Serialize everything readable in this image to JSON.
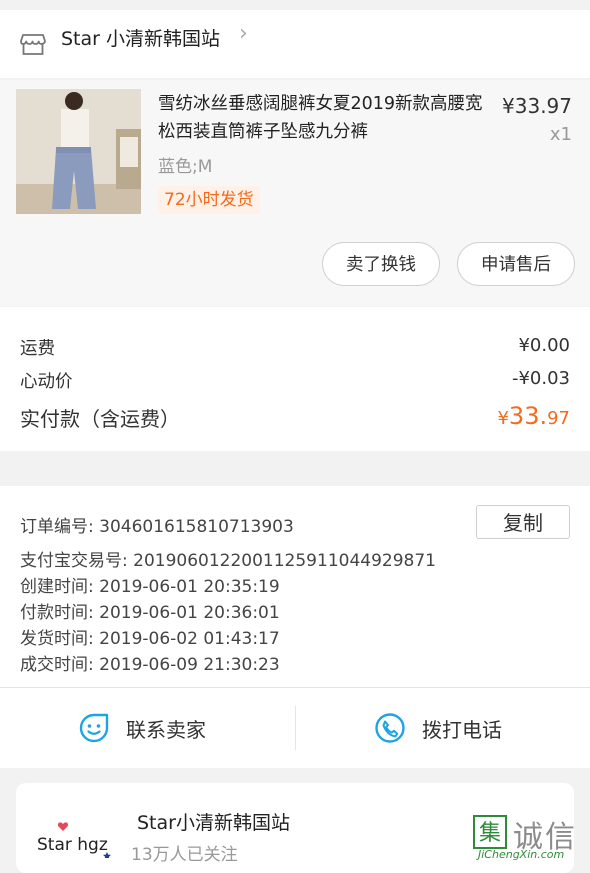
{
  "shop": {
    "name": "Star 小清新韩国站"
  },
  "product": {
    "title": "雪纺冰丝垂感阔腿裤女夏2019新款高腰宽松西装直筒裤子坠感九分裤",
    "spec": "蓝色;M",
    "tag": "72小时发货",
    "price": "¥33.97",
    "qty": "x1",
    "actions": {
      "sell": "卖了换钱",
      "after_sale": "申请售后"
    }
  },
  "fees": {
    "shipping_label": "运费",
    "shipping_value": "¥0.00",
    "discount_label": "心动价",
    "discount_value": "-¥0.03",
    "total_label": "实付款（含运费）",
    "total_symbol": "¥",
    "total_int": "33.",
    "total_dec": "97"
  },
  "order": {
    "number": "订单编号:  304601615810713903",
    "copy": "复制",
    "alipay": "支付宝交易号:  2019060122001125911044929871",
    "created": "创建时间:  2019-06-01 20:35:19",
    "paid": "付款时间:  2019-06-01 20:36:01",
    "shipped": "发货时间:  2019-06-02 01:43:17",
    "completed": "成交时间:  2019-06-09 21:30:23",
    "contact_seller": "联系卖家",
    "call": "拨打电话"
  },
  "store": {
    "name": "Star小清新韩国站",
    "followers": "13万人已关注",
    "logo_text": "Star hgz"
  },
  "watermark": {
    "mark": "集",
    "text": "诚信",
    "url": "JiChengXin.com"
  },
  "colors": {
    "accent": "#f56a1b",
    "icon_blue": "#1ea3e3"
  }
}
